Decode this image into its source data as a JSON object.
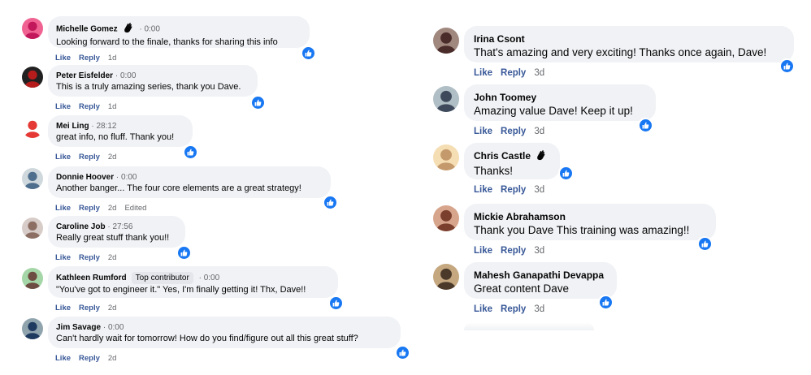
{
  "left_comments": [
    {
      "author": "Michelle Gomez",
      "wave": true,
      "badge": "",
      "time": "0:00",
      "text": "Looking forward to the finale, thanks for sharing this info",
      "like": "Like",
      "reply": "Reply",
      "age": "1d",
      "edited": ""
    },
    {
      "author": "Peter Eisfelder",
      "wave": false,
      "badge": "",
      "time": "0:00",
      "text": "This is a truly amazing series, thank you Dave.",
      "like": "Like",
      "reply": "Reply",
      "age": "1d",
      "edited": ""
    },
    {
      "author": "Mei Ling",
      "wave": false,
      "badge": "",
      "time": "28:12",
      "text": "great info, no fluff. Thank you!",
      "like": "Like",
      "reply": "Reply",
      "age": "2d",
      "edited": ""
    },
    {
      "author": "Donnie Hoover",
      "wave": false,
      "badge": "",
      "time": "0:00",
      "text": "Another banger... The four core elements are a great strategy!",
      "like": "Like",
      "reply": "Reply",
      "age": "2d",
      "edited": "Edited"
    },
    {
      "author": "Caroline Job",
      "wave": false,
      "badge": "",
      "time": "27:56",
      "text": "Really great stuff thank you!!",
      "like": "Like",
      "reply": "Reply",
      "age": "2d",
      "edited": ""
    },
    {
      "author": "Kathleen Rumford",
      "wave": false,
      "badge": "Top contributor",
      "time": "0:00",
      "text": "\"You've got to engineer it.\" Yes, I'm finally getting it! Thx, Dave!!",
      "like": "Like",
      "reply": "Reply",
      "age": "2d",
      "edited": ""
    },
    {
      "author": "Jim Savage",
      "wave": false,
      "badge": "",
      "time": "0:00",
      "text": "Can't hardly wait for tomorrow! How do you find/figure out all this great stuff?",
      "like": "Like",
      "reply": "Reply",
      "age": "2d",
      "edited": ""
    }
  ],
  "right_comments": [
    {
      "author": "Irina Csont",
      "wave": false,
      "text": "That's amazing and very exciting! Thanks once again, Dave!",
      "like": "Like",
      "reply": "Reply",
      "age": "3d"
    },
    {
      "author": "John Toomey",
      "wave": false,
      "text": "Amazing value Dave! Keep it up!",
      "like": "Like",
      "reply": "Reply",
      "age": "3d"
    },
    {
      "author": "Chris Castle",
      "wave": true,
      "text": "Thanks!",
      "like": "Like",
      "reply": "Reply",
      "age": "3d"
    },
    {
      "author": "Mickie Abrahamson",
      "wave": false,
      "text": "Thank you Dave This training was amazing!!",
      "like": "Like",
      "reply": "Reply",
      "age": "3d"
    },
    {
      "author": "Mahesh Ganapathi Devappa",
      "wave": false,
      "text": "Great content Dave",
      "like": "Like",
      "reply": "Reply",
      "age": "3d"
    }
  ],
  "icons": {
    "reaction": "thumbs-up-icon",
    "wave": "wave-icon"
  },
  "colors": {
    "bubble": "#f0f2f5",
    "like_blue": "#1877f2",
    "link": "#385898",
    "muted": "#65676b"
  }
}
